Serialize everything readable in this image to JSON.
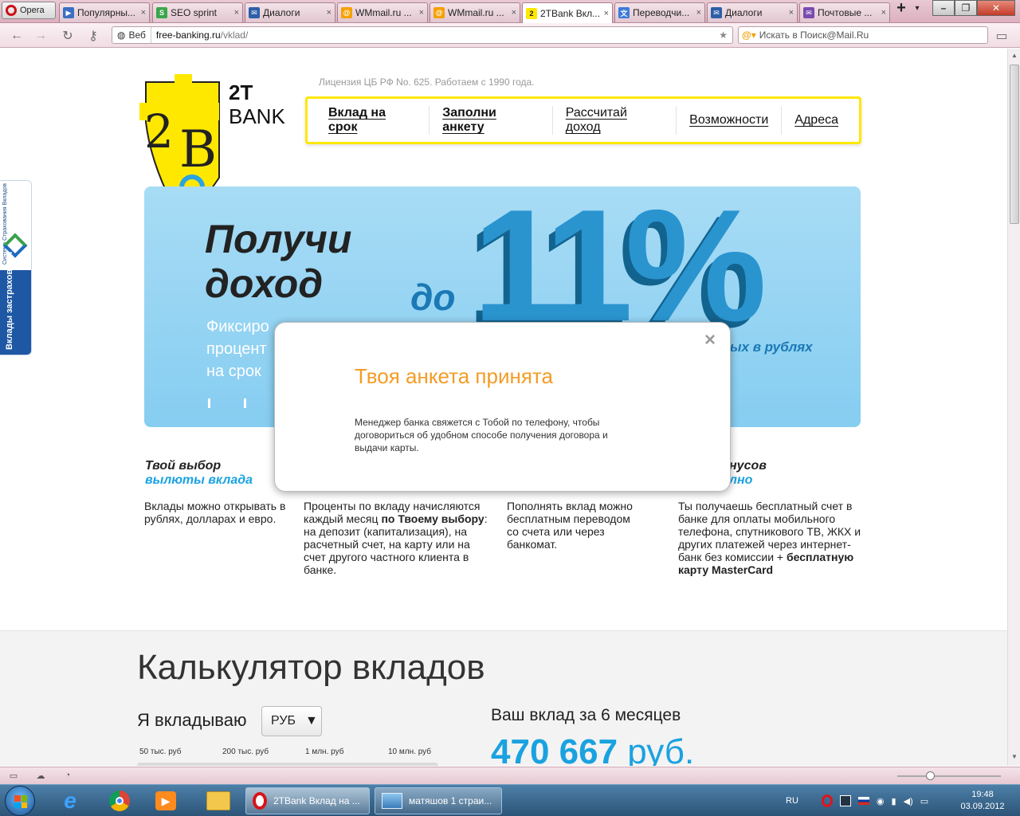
{
  "browser": {
    "app_name": "Opera",
    "tabs": [
      {
        "label": "Популярны...",
        "icon": "video-icon",
        "color": "#3a6fc4"
      },
      {
        "label": "SEO sprint",
        "icon": "seo-sprint-icon",
        "color": "#3aa64a"
      },
      {
        "label": "Диалоги",
        "icon": "chat-icon",
        "color": "#2d5fa8"
      },
      {
        "label": "WMmail.ru ...",
        "icon": "wmmail-icon",
        "color": "#f5a000"
      },
      {
        "label": "WMmail.ru ...",
        "icon": "wmmail-icon",
        "color": "#f5a000"
      },
      {
        "label": "2TBank Вкл...",
        "icon": "2tbank-icon",
        "color": "#ffe800",
        "active": true
      },
      {
        "label": "Переводчи...",
        "icon": "translate-icon",
        "color": "#3d7ad9"
      },
      {
        "label": "Диалоги",
        "icon": "chat-icon",
        "color": "#2d5fa8"
      },
      {
        "label": "Почтовые ...",
        "icon": "mail-icon",
        "color": "#7a4bb0"
      }
    ],
    "address": {
      "mode": "Веб",
      "host": "free-banking.ru",
      "path": "/vklad/"
    },
    "search_placeholder": "Искать в Поиск@Mail.Ru"
  },
  "site": {
    "license": "Лицензия ЦБ РФ No. 625. Работаем с 1990 года.",
    "logo_top": "2T",
    "logo_bottom": "BANK",
    "menu": [
      {
        "label": "Вклад на срок",
        "active": true
      },
      {
        "label": "Заполни анкету",
        "active": true
      },
      {
        "label": "Рассчитай доход"
      },
      {
        "label": "Возможности"
      },
      {
        "label": "Адреса"
      }
    ],
    "insurance_badge": {
      "top": "Система Страхования Вкладов",
      "bottom": "Вклады застрахованы"
    },
    "banner": {
      "title_line1": "Получи",
      "title_line2": "доход",
      "subtitle_line1": "Фиксиро",
      "subtitle_line2": "процент",
      "subtitle_line3": "на срок",
      "prefix": "до",
      "rate": "11%",
      "suffix": "ых в рублях"
    },
    "features": [
      {
        "h1": "Твой выбор",
        "h2": "вылюты вклада",
        "text": "Вклады можно открывать в рублях, долларах и евро."
      },
      {
        "text_a": "Проценты по вкладу начисляются каждый месяц ",
        "text_b": "по Твоему выбору",
        "text_c": ": на депозит (капитализация), на расчетный счет, на карту или на счет другого частного клиента в банке."
      },
      {
        "text": "Пополнять вклад можно бесплатным переводом со счета или через банкомат."
      },
      {
        "h1": "нусов",
        "h2": "лно",
        "text_a": "Ты получаешь бесплатный счет в банке для оплаты мобильного телефона, спутникового ТВ, ЖКХ и других платежей через интернет-банк без комиссии + ",
        "text_b": "бесплатную карту MasterCard"
      }
    ],
    "calculator": {
      "title": "Калькулятор вкладов",
      "deposit_label": "Я вкладываю",
      "currency": "РУБ",
      "ticks": [
        "50 тыс. руб",
        "200 тыс. руб",
        "1 млн. руб",
        "10 млн. руб"
      ],
      "result_label": "Ваш вклад за 6 месяцев",
      "result_value": "470 667",
      "result_unit": "руб."
    }
  },
  "modal": {
    "title": "Твоя анкета принята",
    "text": "Менеджер банка свяжется с Тобой по телефону, чтобы договориться об удобном способе получения договора и выдачи карты.",
    "close": "×"
  },
  "taskbar": {
    "tasks": [
      {
        "label": "2TBank Вклад на ...",
        "icon": "opera-icon",
        "active": true
      },
      {
        "label": "матяшов 1 страи...",
        "icon": "image-viewer-icon"
      }
    ],
    "lang": "RU",
    "time": "19:48",
    "date": "03.09.2012"
  }
}
